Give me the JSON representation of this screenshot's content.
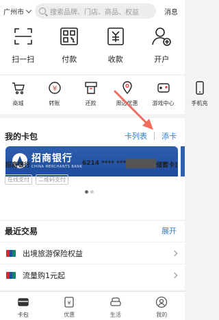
{
  "topbar": {
    "city": "广州市",
    "search_placeholder": "搜索品牌、门店、商品、权益",
    "message": "消息"
  },
  "quick_actions": [
    {
      "label": "扫一扫",
      "icon": "scan-icon"
    },
    {
      "label": "付款",
      "icon": "qr-code-icon"
    },
    {
      "label": "收款",
      "icon": "receive-money-icon"
    },
    {
      "label": "开户",
      "icon": "add-user-icon"
    }
  ],
  "services": [
    {
      "label": "商城",
      "icon": "cart-icon"
    },
    {
      "label": "转账",
      "icon": "transfer-icon"
    },
    {
      "label": "还款",
      "icon": "repay-icon"
    },
    {
      "label": "周边优惠",
      "icon": "location-icon"
    },
    {
      "label": "游戏中心",
      "icon": "gamepad-icon"
    },
    {
      "label": "手机充",
      "icon": "phone-icon"
    }
  ],
  "card_package": {
    "title": "我的卡包",
    "list_link": "卡列表",
    "add_link": "添卡",
    "card": {
      "bank_name_cn": "招商银行",
      "bank_name_en": "CHINA MERCHANTS BANK",
      "holder_bank": "招商银行",
      "number": "6214 **** ****",
      "type": "储蓄卡]",
      "tags": [
        "在线支付",
        "二维码支付"
      ]
    },
    "pager": {
      "count": 2,
      "active": 1
    }
  },
  "recent": {
    "title": "最近交易",
    "expand": "展开",
    "items": [
      {
        "label": "出境旅游保险权益"
      },
      {
        "label": "流量购1元起"
      }
    ]
  },
  "bottom_nav": [
    {
      "label": "卡包",
      "icon": "card-icon",
      "active": true
    },
    {
      "label": "优惠",
      "icon": "coupon-icon",
      "active": false
    },
    {
      "label": "生活",
      "icon": "sofa-icon",
      "active": false
    },
    {
      "label": "我的",
      "icon": "profile-icon",
      "active": false
    }
  ],
  "colors": {
    "accent": "#2f7dd6",
    "card_bg": "#1e4b9c",
    "annotation": "#f26b5b",
    "icon_red": "#e33b3b"
  }
}
